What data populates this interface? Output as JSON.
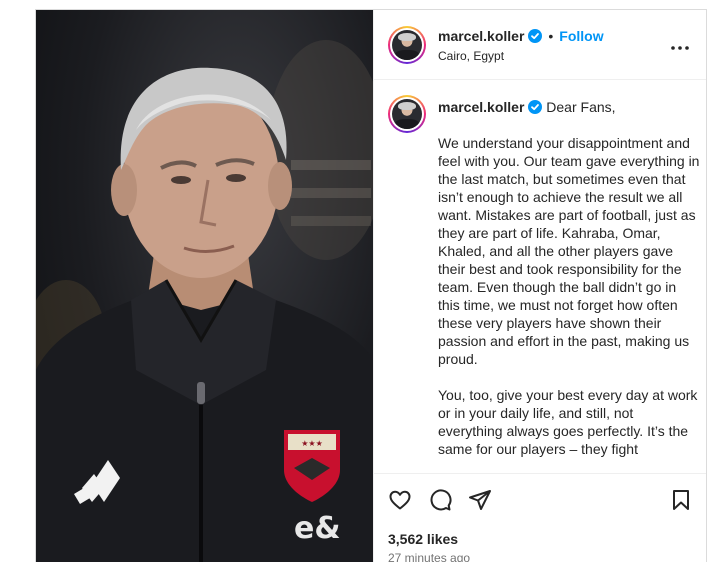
{
  "post": {
    "author": {
      "username": "marcel.koller",
      "location": "Cairo, Egypt",
      "follow_label": "Follow",
      "separator": "•"
    },
    "caption": {
      "greeting": "Dear Fans,",
      "paragraphs": [
        "We understand your disappointment and feel with you. Our team gave everything in the last match, but sometimes even that isn’t enough to achieve the result we all want. Mistakes are part of football, just as they are part of life. Kahraba, Omar, Khaled, and all the other players gave their best and took responsibility for the team. Even though the ball didn’t go in this time, we must not forget how often these very players have shown their passion and effort in the past, making us proud.",
        "You, too, give your best every day at work or in your daily life, and still, not everything always goes perfectly. It’s the same for our players – they fight"
      ]
    },
    "likes": "3,562 likes",
    "time_ago": "27 minutes ago",
    "icons": {
      "verified": "verified-badge-icon",
      "more": "more-options-icon",
      "like": "heart-icon",
      "comment": "comment-icon",
      "share": "share-icon",
      "save": "bookmark-icon"
    },
    "colors": {
      "link": "#0095f6",
      "verified": "#0095f6",
      "text": "#262626",
      "muted": "#737373"
    }
  }
}
